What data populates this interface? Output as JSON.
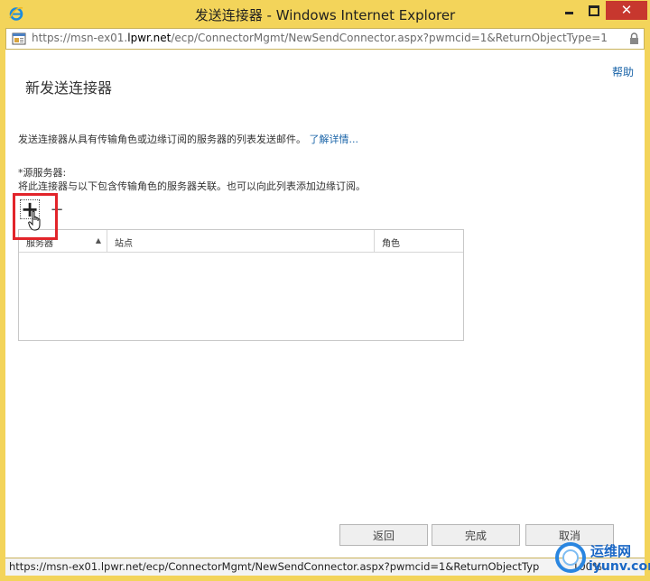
{
  "window": {
    "title": "发送连接器 - Windows Internet Explorer"
  },
  "address": {
    "url_prefix": "https://msn-ex01.",
    "url_host": "lpwr.net",
    "url_path": "/ecp/ConnectorMgmt/NewSendConnector.aspx?pwmcid=1&ReturnObjectType=1"
  },
  "page": {
    "help": "帮助",
    "title": "新发送连接器",
    "description": "发送连接器从具有传输角色或边缘订阅的服务器的列表发送邮件。",
    "learn_more": "了解详情...",
    "source_label": "*源服务器:",
    "source_hint": "将此连接器与以下包含传输角色的服务器关联。也可以向此列表添加边缘订阅。",
    "add_symbol": "+",
    "remove_symbol": "−"
  },
  "grid": {
    "columns": [
      "服务器",
      "站点",
      "角色"
    ],
    "sort_indicator": "▲",
    "rows": []
  },
  "buttons": {
    "back": "返回",
    "finish": "完成",
    "cancel": "取消"
  },
  "statusbar": {
    "url": "https://msn-ex01.lpwr.net/ecp/ConnectorMgmt/NewSendConnector.aspx?pwmcid=1&ReturnObjectTyp",
    "zoom": "100%"
  },
  "watermark": {
    "name": "运维网",
    "domain": "iyunv.com"
  },
  "colors": {
    "frame": "#f3d45a",
    "close_button": "#c7372e",
    "link": "#1a64a8",
    "highlight": "#e2242a"
  }
}
